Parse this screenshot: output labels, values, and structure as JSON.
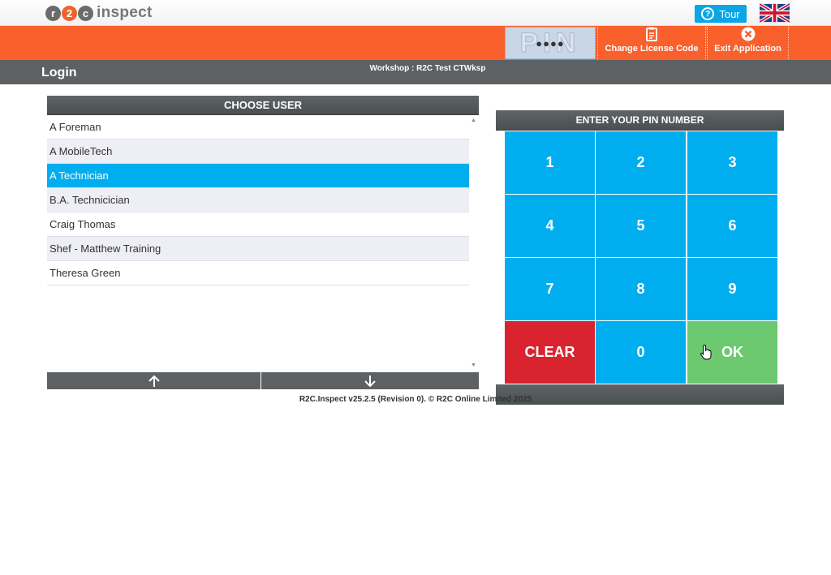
{
  "header": {
    "logo_letters": [
      "r",
      "2",
      "c"
    ],
    "logo_text": "inspect",
    "tour_label": "Tour",
    "tour_icon": "help-circle-icon",
    "language_flag": "uk-flag-icon",
    "pin_dots": "●●●●",
    "pin_watermark": "PIN",
    "change_license_label": "Change License Code",
    "exit_label": "Exit Application"
  },
  "subheader": {
    "title": "Login",
    "workshop": "Workshop : R2C Test CTWksp"
  },
  "user_panel": {
    "heading": "CHOOSE USER",
    "users": [
      "A Foreman",
      "A MobileTech",
      "A Technician",
      "B.A. Technicician",
      "Craig Thomas",
      "Shef - Matthew Training",
      "Theresa Green"
    ],
    "selected": "A Technician",
    "up_icon": "arrow-up-icon",
    "down_icon": "arrow-down-icon"
  },
  "keypad": {
    "heading": "ENTER YOUR PIN NUMBER",
    "keys": [
      "1",
      "2",
      "3",
      "4",
      "5",
      "6",
      "7",
      "8",
      "9",
      "CLEAR",
      "0",
      "OK"
    ]
  },
  "footer": {
    "version": "R2C.Inspect v25.2.5 (Revision 0). © R2C Online Limited 2025"
  },
  "colors": {
    "orange": "#f9602c",
    "blue": "#00aeef",
    "red": "#d9232e",
    "green": "#6cc96f",
    "dark_grey": "#5d6163"
  }
}
